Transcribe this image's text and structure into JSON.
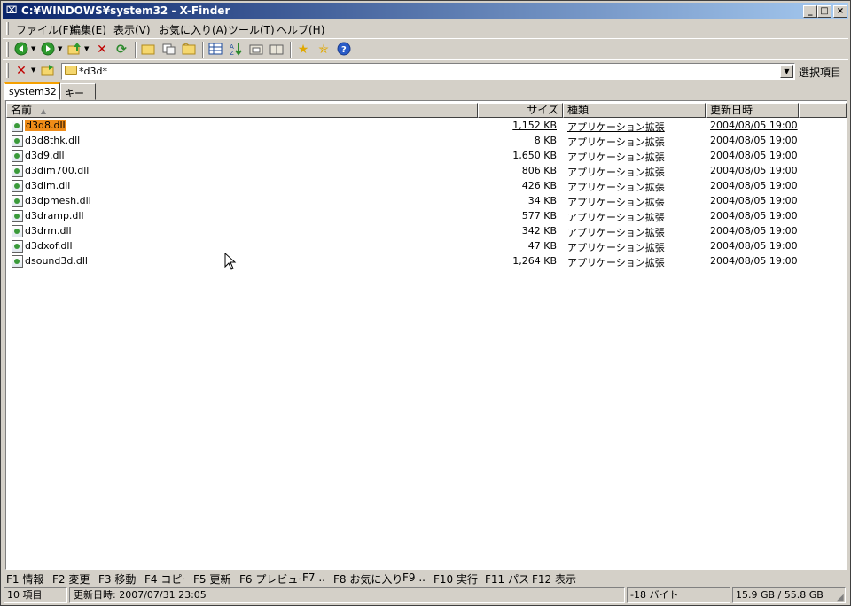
{
  "window": {
    "title": "C:¥WINDOWS¥system32 - X-Finder",
    "min_label": "_",
    "max_label": "□",
    "close_label": "×"
  },
  "menu": [
    {
      "label": "ファイル(F)"
    },
    {
      "label": "編集(E)"
    },
    {
      "label": "表示(V)"
    },
    {
      "label": "お気に入り(A)"
    },
    {
      "label": "ツール(T)"
    },
    {
      "label": "ヘルプ(H)"
    }
  ],
  "address": {
    "value": "*d3d*",
    "select_label": "選択項目"
  },
  "tabs": [
    {
      "label": "system32"
    },
    {
      "label": "キー"
    }
  ],
  "columns": {
    "name": "名前",
    "size": "サイズ",
    "type": "種類",
    "date": "更新日時"
  },
  "files": [
    {
      "name": "d3d8.dll",
      "size": "1,152 KB",
      "type": "アプリケーション拡張",
      "date": "2004/08/05 19:00"
    },
    {
      "name": "d3d8thk.dll",
      "size": "8 KB",
      "type": "アプリケーション拡張",
      "date": "2004/08/05 19:00"
    },
    {
      "name": "d3d9.dll",
      "size": "1,650 KB",
      "type": "アプリケーション拡張",
      "date": "2004/08/05 19:00"
    },
    {
      "name": "d3dim700.dll",
      "size": "806 KB",
      "type": "アプリケーション拡張",
      "date": "2004/08/05 19:00"
    },
    {
      "name": "d3dim.dll",
      "size": "426 KB",
      "type": "アプリケーション拡張",
      "date": "2004/08/05 19:00"
    },
    {
      "name": "d3dpmesh.dll",
      "size": "34 KB",
      "type": "アプリケーション拡張",
      "date": "2004/08/05 19:00"
    },
    {
      "name": "d3dramp.dll",
      "size": "577 KB",
      "type": "アプリケーション拡張",
      "date": "2004/08/05 19:00"
    },
    {
      "name": "d3drm.dll",
      "size": "342 KB",
      "type": "アプリケーション拡張",
      "date": "2004/08/05 19:00"
    },
    {
      "name": "d3dxof.dll",
      "size": "47 KB",
      "type": "アプリケーション拡張",
      "date": "2004/08/05 19:00"
    },
    {
      "name": "dsound3d.dll",
      "size": "1,264 KB",
      "type": "アプリケーション拡張",
      "date": "2004/08/05 19:00"
    }
  ],
  "fkeys": [
    {
      "label": "F1 情報"
    },
    {
      "label": "F2 変更"
    },
    {
      "label": "F3 移動"
    },
    {
      "label": "F4 コピー"
    },
    {
      "label": "F5 更新"
    },
    {
      "label": "F6 プレビュー"
    },
    {
      "label": "F7 .."
    },
    {
      "label": "F8 お気に入り"
    },
    {
      "label": "F9 .."
    },
    {
      "label": "F10 実行"
    },
    {
      "label": "F11 パス"
    },
    {
      "label": "F12 表示"
    }
  ],
  "status": {
    "count": "10 項目",
    "modified": "更新日時: 2007/07/31 23:05",
    "bytes": "-18 バイト",
    "disk": "15.9 GB / 55.8 GB"
  },
  "colors": {
    "selection": "#f08c18",
    "active_tab_accent": "#f5a000",
    "titlebar_start": "#0a246a",
    "titlebar_end": "#a6caf0"
  }
}
